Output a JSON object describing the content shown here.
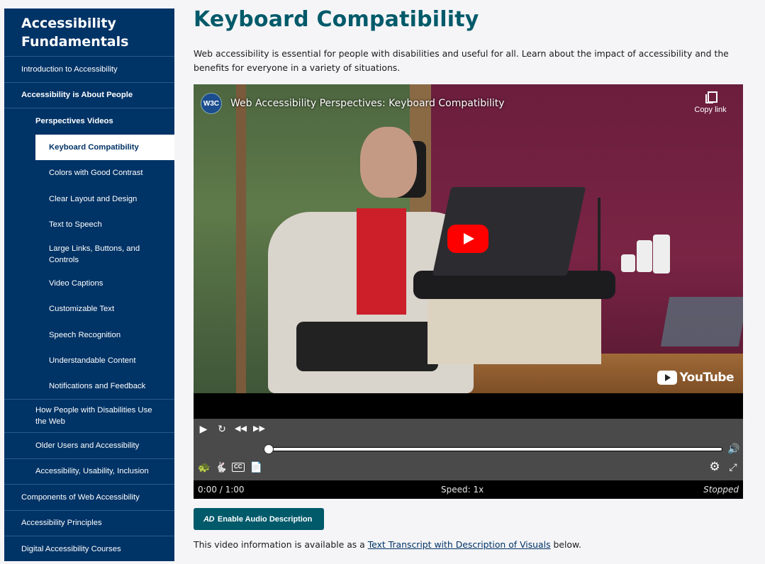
{
  "sidebar": {
    "title": "Accessibility Fundamentals",
    "items": [
      {
        "label": "Introduction to Accessibility"
      },
      {
        "label": "Accessibility is About People"
      },
      {
        "label": "Perspectives Videos"
      },
      {
        "label": "Keyboard Compatibility"
      },
      {
        "label": "Colors with Good Contrast"
      },
      {
        "label": "Clear Layout and Design"
      },
      {
        "label": "Text to Speech"
      },
      {
        "label": "Large Links, Buttons, and Controls"
      },
      {
        "label": "Video Captions"
      },
      {
        "label": "Customizable Text"
      },
      {
        "label": "Speech Recognition"
      },
      {
        "label": "Understandable Content"
      },
      {
        "label": "Notifications and Feedback"
      },
      {
        "label": "How People with Disabilities Use the Web"
      },
      {
        "label": "Older Users and Accessibility"
      },
      {
        "label": "Accessibility, Usability, Inclusion"
      },
      {
        "label": "Components of Web Accessibility"
      },
      {
        "label": "Accessibility Principles"
      },
      {
        "label": "Digital Accessibility Courses"
      }
    ]
  },
  "main": {
    "title": "Keyboard Compatibility",
    "intro": "Web accessibility is essential for people with disabilities and useful for all. Learn about the impact of accessibility and the benefits for everyone in a variety of situations.",
    "video": {
      "logo": "W3C",
      "title": "Web Accessibility Perspectives: Keyboard Compatibility",
      "copy_link": "Copy link",
      "youtube": "YouTube"
    },
    "player": {
      "time": "0:00 / 1:00",
      "speed": "Speed: 1x",
      "state": "Stopped",
      "progress": 0
    },
    "ad_button": {
      "icon": "AD",
      "label": "Enable Audio Description"
    },
    "transcript": {
      "before": "This video information is available as a ",
      "link": "Text Transcript with Description of Visuals",
      "after": " below."
    }
  },
  "colors": {
    "sidebar_bg": "#003366",
    "accent": "#005a6a",
    "youtube_red": "#ff0000"
  }
}
